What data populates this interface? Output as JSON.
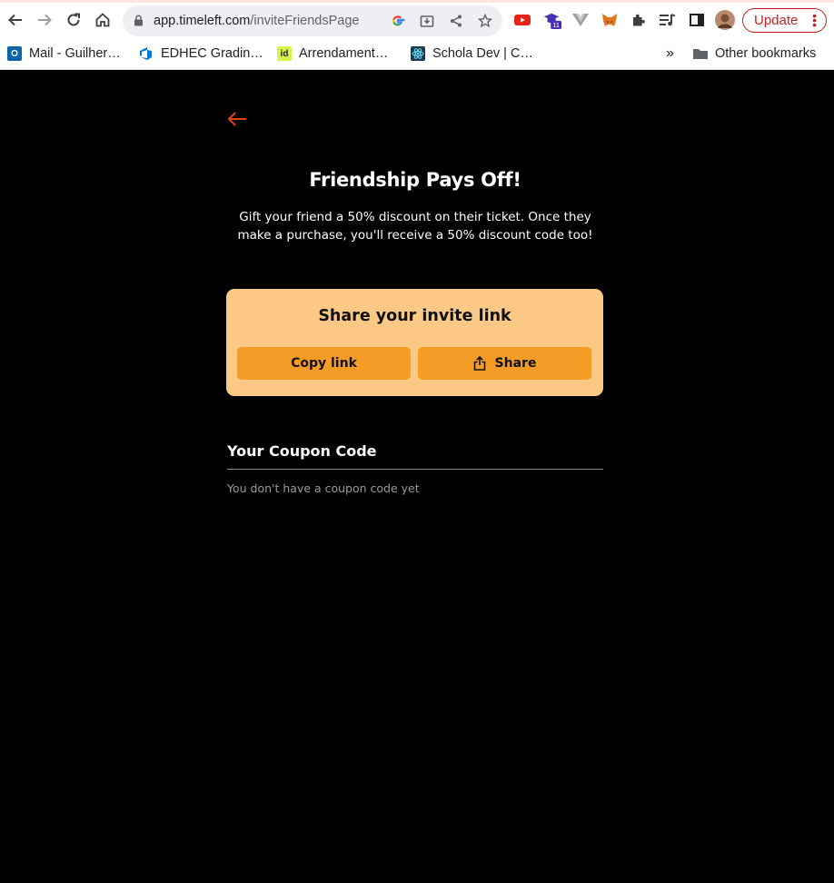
{
  "browser": {
    "url_host": "app.timeleft.com",
    "url_path": "/inviteFriendsPage",
    "update_label": "Update",
    "extension_badge": "11",
    "bookmarks": [
      {
        "label": "Mail - Guilher…",
        "icon": "outlook-icon",
        "color": "#0a64ad"
      },
      {
        "label": "EDHEC Gradin…",
        "icon": "azure-devops-icon",
        "color": "#0078d4"
      },
      {
        "label": "Arrendament…",
        "icon": "idealista-icon",
        "color": "#d9f24a"
      },
      {
        "label": "Schola Dev | C…",
        "icon": "react-icon",
        "color": "#1d3a4a"
      }
    ],
    "overflow_label": "»",
    "other_bookmarks_label": "Other bookmarks"
  },
  "page": {
    "title": "Friendship Pays Off!",
    "subtitle_line1": "Gift your friend a 50% discount on their ticket. Once they",
    "subtitle_line2": "make a purchase, you'll receive a 50% discount code too!",
    "invite_card": {
      "title": "Share your invite link",
      "copy_label": "Copy link",
      "share_label": "Share"
    },
    "coupon": {
      "heading": "Your Coupon Code",
      "empty_text": "You don't have a coupon code yet"
    }
  },
  "colors": {
    "accent_arrow": "#e0421f",
    "card_bg": "#fcc886",
    "button_bg": "#f39c26",
    "page_bg": "#000000"
  }
}
